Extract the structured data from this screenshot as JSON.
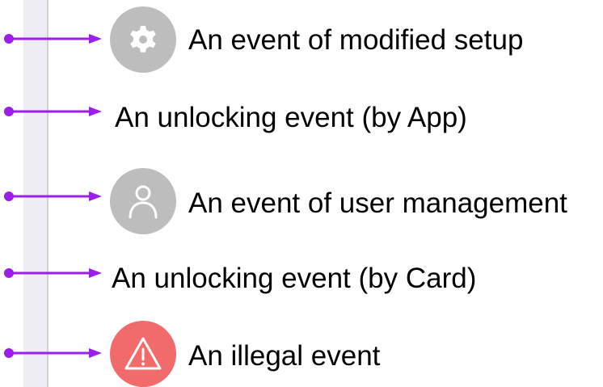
{
  "events": [
    {
      "label": "An event of modified setup",
      "icon": "gear-icon",
      "icon_style": "gray"
    },
    {
      "label": "An unlocking event (by App)",
      "icon": null
    },
    {
      "label": "An event of user management",
      "icon": "user-icon",
      "icon_style": "gray"
    },
    {
      "label": "An unlocking event (by Card)",
      "icon": null
    },
    {
      "label": "An illegal event",
      "icon": "warning-icon",
      "icon_style": "red"
    }
  ],
  "colors": {
    "arrow": "#9b1fe8",
    "icon_gray": "#bdbdbd",
    "icon_red": "#f26b6b",
    "timeline": "#eeedf4"
  }
}
